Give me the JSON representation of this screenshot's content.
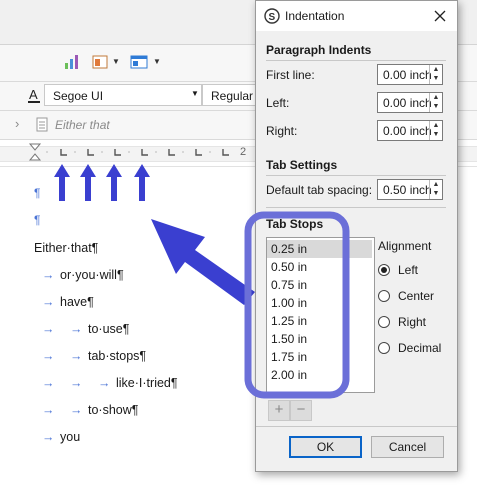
{
  "toolbar": {
    "font_name": "Segoe UI",
    "style_name": "Regular"
  },
  "breadcrumb": {
    "text": "Either that"
  },
  "ruler": {
    "tick_label": "2"
  },
  "document": {
    "pilcrow": "¶",
    "lines": [
      {
        "tabs": 0,
        "text": "Either·that¶"
      },
      {
        "tabs": 1,
        "text": "or·you·will¶"
      },
      {
        "tabs": 1,
        "text": "have¶"
      },
      {
        "tabs": 2,
        "text": "to·use¶"
      },
      {
        "tabs": 2,
        "text": "tab·stops¶"
      },
      {
        "tabs": 3,
        "text": "like·I·tried¶"
      },
      {
        "tabs": 2,
        "text": "to·show¶"
      },
      {
        "tabs": 1,
        "text": "you"
      }
    ]
  },
  "dialog": {
    "title": "Indentation",
    "paragraph_indents": {
      "heading": "Paragraph Indents",
      "first_line_label": "First line:",
      "first_line_value": "0.00 inch",
      "left_label": "Left:",
      "left_value": "0.00 inch",
      "right_label": "Right:",
      "right_value": "0.00 inch"
    },
    "tab_settings": {
      "heading": "Tab Settings",
      "default_label": "Default tab spacing:",
      "default_value": "0.50 inch"
    },
    "tab_stops": {
      "heading": "Tab Stops",
      "items": [
        "0.25 in",
        "0.50 in",
        "0.75 in",
        "1.00 in",
        "1.25 in",
        "1.50 in",
        "1.75 in",
        "2.00 in"
      ],
      "selected_index": 0,
      "add_label": "+",
      "remove_label": "−"
    },
    "alignment": {
      "heading": "Alignment",
      "options": [
        "Left",
        "Center",
        "Right",
        "Decimal"
      ],
      "selected": "Left"
    },
    "buttons": {
      "ok": "OK",
      "cancel": "Cancel"
    }
  },
  "colors": {
    "annotation_blue": "#3a3fd0",
    "highlight_box": "#6b6fd8",
    "pilcrow_blue": "#4b74d6"
  }
}
